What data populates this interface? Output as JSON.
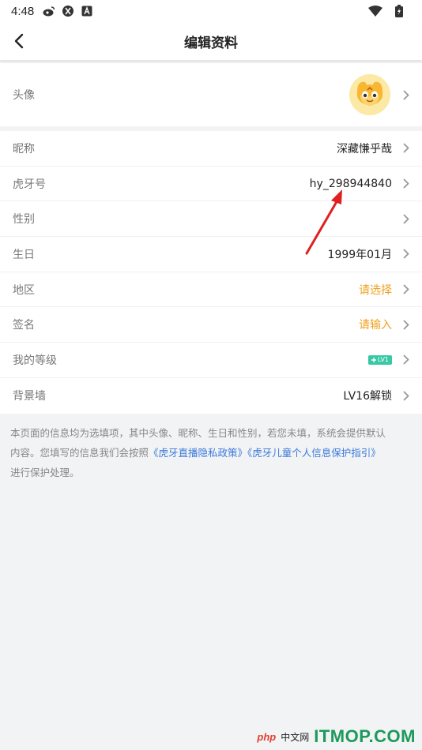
{
  "status_bar": {
    "time": "4:48",
    "left_icons": [
      "weibo-icon",
      "app-icon",
      "a-letter-icon"
    ],
    "right_icons": [
      "wifi-icon",
      "battery-icon"
    ]
  },
  "header": {
    "title": "编辑资料"
  },
  "profile": {
    "avatar_label": "头像",
    "rows": [
      {
        "label": "昵称",
        "value": "深藏慊乎哉",
        "style": "normal"
      },
      {
        "label": "虎牙号",
        "value": "hy_298944840",
        "style": "normal"
      },
      {
        "label": "性别",
        "value": "",
        "style": "normal"
      },
      {
        "label": "生日",
        "value": "1999年01月",
        "style": "normal"
      },
      {
        "label": "地区",
        "value": "请选择",
        "style": "orange"
      },
      {
        "label": "签名",
        "value": "请输入",
        "style": "orange"
      },
      {
        "label": "我的等级",
        "value": "LV1",
        "style": "badge"
      },
      {
        "label": "背景墙",
        "value": "LV16解锁",
        "style": "normal"
      }
    ]
  },
  "footer": {
    "line1": "本页面的信息均为选填项，其中头像、昵称、生日和性别，若您未填，系统会提供默认",
    "line2_prefix": "内容。您填写的信息我们会按照",
    "link1": "《虎牙直播隐私政策》",
    "link2": "《虎牙儿童个人信息保护指引》",
    "line3": "进行保护处理。"
  },
  "watermark": {
    "php": "php",
    "zh": "中文网",
    "site": "ITMOP.COM"
  },
  "colors": {
    "accent_orange": "#f0a020",
    "link_blue": "#3b7ad9",
    "badge_green": "#39c8a4",
    "annotation_red": "#e02020"
  }
}
